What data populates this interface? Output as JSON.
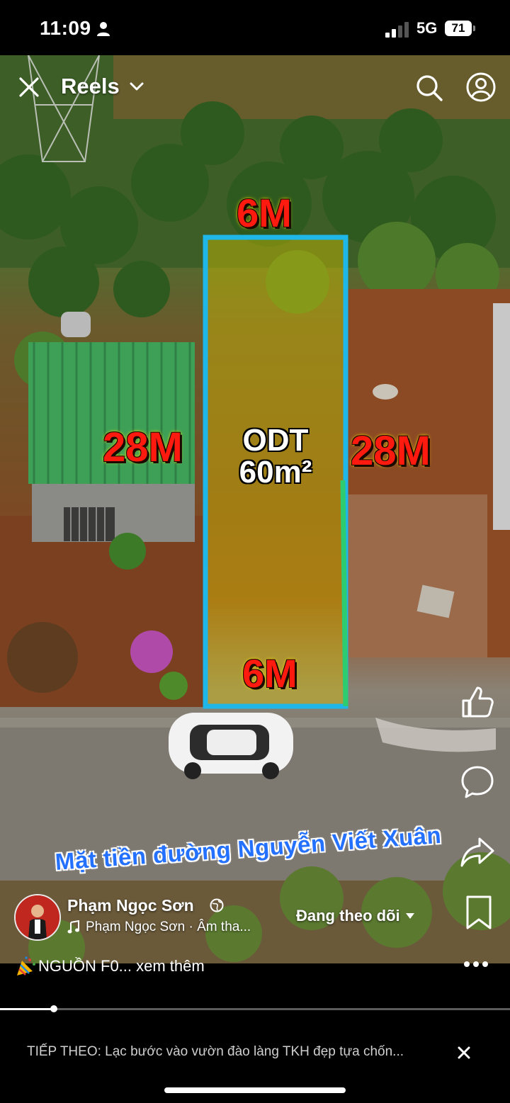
{
  "status_bar": {
    "time": "11:09",
    "network": "5G",
    "battery": "71",
    "icons": [
      "person-icon",
      "signal-icon",
      "battery-icon"
    ]
  },
  "header": {
    "title": "Reels",
    "icons": [
      "close-icon",
      "chevron-down-icon",
      "search-icon",
      "profile-icon"
    ]
  },
  "video": {
    "overlay": {
      "width_top": "6M",
      "width_bottom": "6M",
      "length_left": "28M",
      "length_right": "28M",
      "zoning": "ODT",
      "area": "60m²",
      "street": "Mặt tiền đường Nguyễn Viết Xuân"
    },
    "colors": {
      "outline": "#1fb6e8",
      "plot_fill": "#d8c400",
      "label_red": "#ff1a10",
      "street_blue": "#2470ff"
    }
  },
  "actions": {
    "icons": [
      "like-icon",
      "comment-icon",
      "share-icon",
      "bookmark-icon"
    ]
  },
  "author": {
    "name": "Phạm Ngọc Sơn",
    "audio": "Phạm Ngọc Sơn · Âm tha...",
    "follow_label": "Đang theo dõi",
    "icons": [
      "globe-icon",
      "music-icon",
      "chevron-down-icon"
    ]
  },
  "caption": {
    "text": "NGUỒN F0... xem thêm",
    "icon": "party-popper-icon"
  },
  "playback": {
    "progress": 0.105
  },
  "up_next": {
    "text": "TIẾP THEO: Lạc bước vào vườn đào làng TKH đẹp tựa chốn..."
  }
}
